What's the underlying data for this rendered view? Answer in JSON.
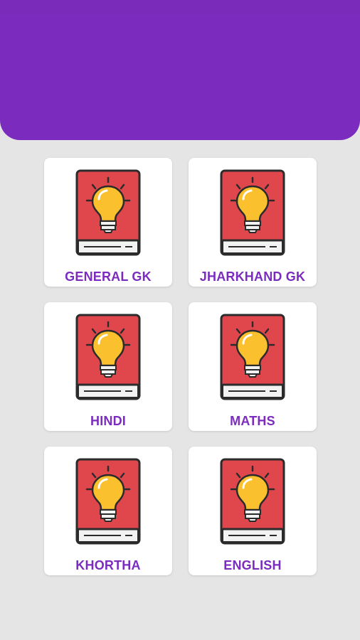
{
  "app": {
    "accent_color": "#7b2cbf",
    "background_color": "#e5e5e5"
  },
  "categories": [
    {
      "label": "GENERAL GK",
      "icon": "book-lightbulb-icon"
    },
    {
      "label": "JHARKHAND GK",
      "icon": "book-lightbulb-icon"
    },
    {
      "label": "HINDI",
      "icon": "book-lightbulb-icon"
    },
    {
      "label": "MATHS",
      "icon": "book-lightbulb-icon"
    },
    {
      "label": "KHORTHA",
      "icon": "book-lightbulb-icon"
    },
    {
      "label": "ENGLISH",
      "icon": "book-lightbulb-icon"
    }
  ]
}
